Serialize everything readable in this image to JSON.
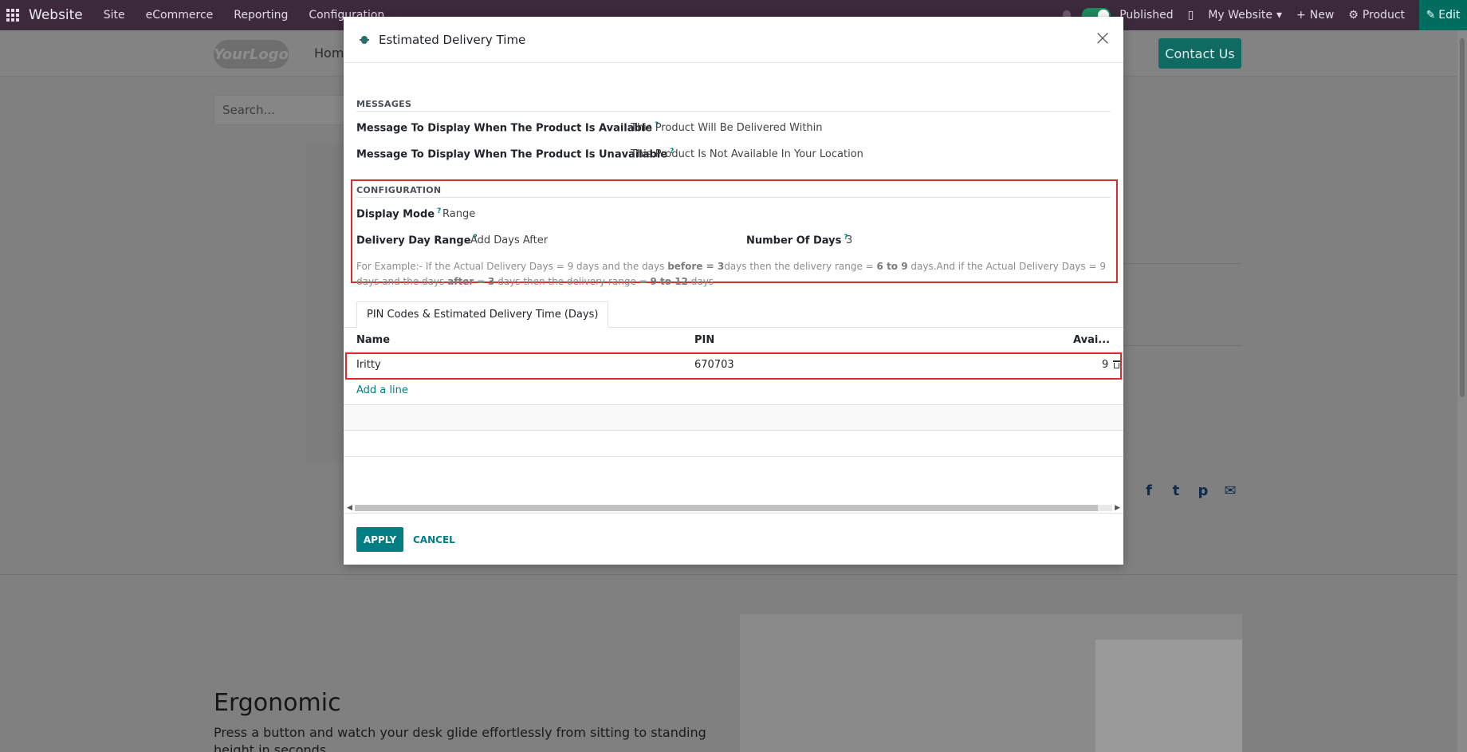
{
  "navbar": {
    "brand": "Website",
    "menus": [
      "Site",
      "eCommerce",
      "Reporting",
      "Configuration"
    ],
    "published_label": "Published",
    "website_selector": "My Website",
    "new_label": "New",
    "product_label": "Product",
    "edit_label": "Edit"
  },
  "site": {
    "logo_text": "YourLogo",
    "home_label": "Home",
    "contact_label": "Contact Us",
    "search_placeholder": "Search...",
    "hero_title": "Ergonomic",
    "hero_text": "Press a button and watch your desk glide effortlessly from sitting to standing height in seconds."
  },
  "modal": {
    "title": "Estimated Delivery Time",
    "messages": {
      "section_title": "MESSAGES",
      "available_label": "Message To Display When The Product Is Available",
      "available_value": "This Product Will Be Delivered Within",
      "unavailable_label": "Message To Display When The Product Is Unavailable",
      "unavailable_value": "This Product Is Not Available In Your Location"
    },
    "configuration": {
      "section_title": "CONFIGURATION",
      "display_mode_label": "Display Mode",
      "display_mode_value": "Range",
      "day_range_label": "Delivery Day Range",
      "day_range_value": "Add Days After",
      "number_of_days_label": "Number Of Days",
      "number_of_days_value": "3",
      "example": {
        "t1": "For Example:- If the Actual Delivery Days = 9 days and the days ",
        "b1": "before = 3",
        "t2": "days then the delivery range = ",
        "b2": "6 to 9",
        "t3": " days.And if the Actual Delivery Days = 9 days and the days ",
        "b3": "after",
        "t4": " = ",
        "b4": "3",
        "t5": " days then the delivery range = ",
        "b5": "9 to 12",
        "t6": " days"
      }
    },
    "tab_label": "PIN Codes & Estimated Delivery Time (Days)",
    "table": {
      "columns": [
        "Name",
        "PIN",
        "Avai..."
      ],
      "rows": [
        {
          "name": "Iritty",
          "pin": "670703",
          "available": "9"
        }
      ],
      "add_line": "Add a line"
    },
    "apply_label": "APPLY",
    "cancel_label": "CANCEL"
  }
}
